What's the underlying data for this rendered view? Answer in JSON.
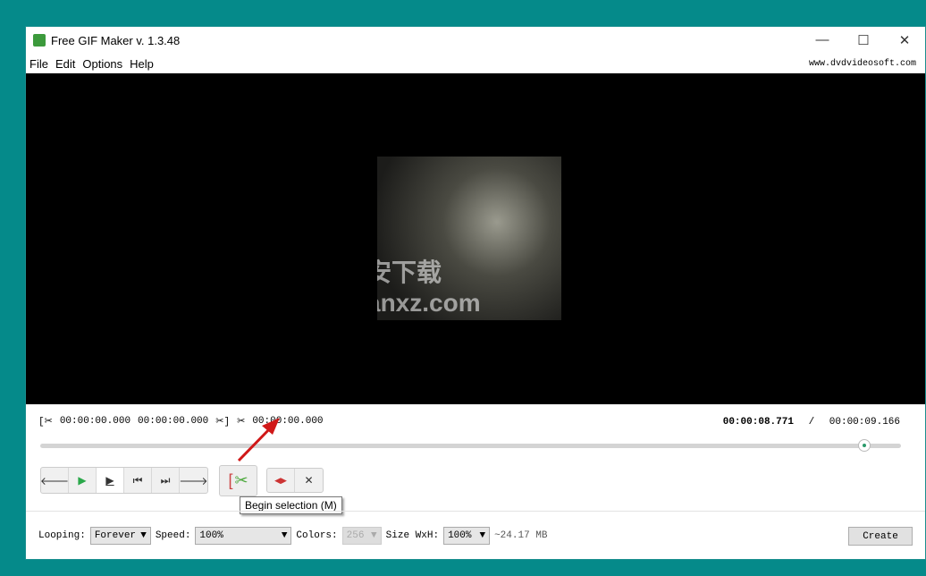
{
  "title": "Free GIF Maker v. 1.3.48",
  "window_buttons": {
    "minimize": "—",
    "maximize": "☐",
    "close": "✕"
  },
  "menu": [
    "File",
    "Edit",
    "Options",
    "Help"
  ],
  "site": "www.dvdvideosoft.com",
  "watermark": "安下载 anxz.com",
  "times": {
    "start": "00:00:00.000",
    "end": "00:00:00.000",
    "duration": "00:00:00.000",
    "current": "00:00:08.771",
    "sep": "/",
    "total": "00:00:09.166"
  },
  "playback_progress": 0.957,
  "controls": {
    "prev": "🡐",
    "play": "▶",
    "play_sel": "▶",
    "first": "⏮",
    "last": "⏭",
    "next": "🡒",
    "begin_sel": "✂",
    "move": "◀▶",
    "clear": "✕"
  },
  "tooltip": "Begin selection (M)",
  "bottom": {
    "looping_label": "Looping:",
    "looping": "Forever",
    "speed_label": "Speed:",
    "speed": "100%",
    "colors_label": "Colors:",
    "colors": "256",
    "size_label": "Size WxH:",
    "size": "100%",
    "filesize": "~24.17 MB",
    "create": "Create"
  },
  "colors": {
    "accent": "#4aa83a",
    "background": "#058a8a"
  }
}
